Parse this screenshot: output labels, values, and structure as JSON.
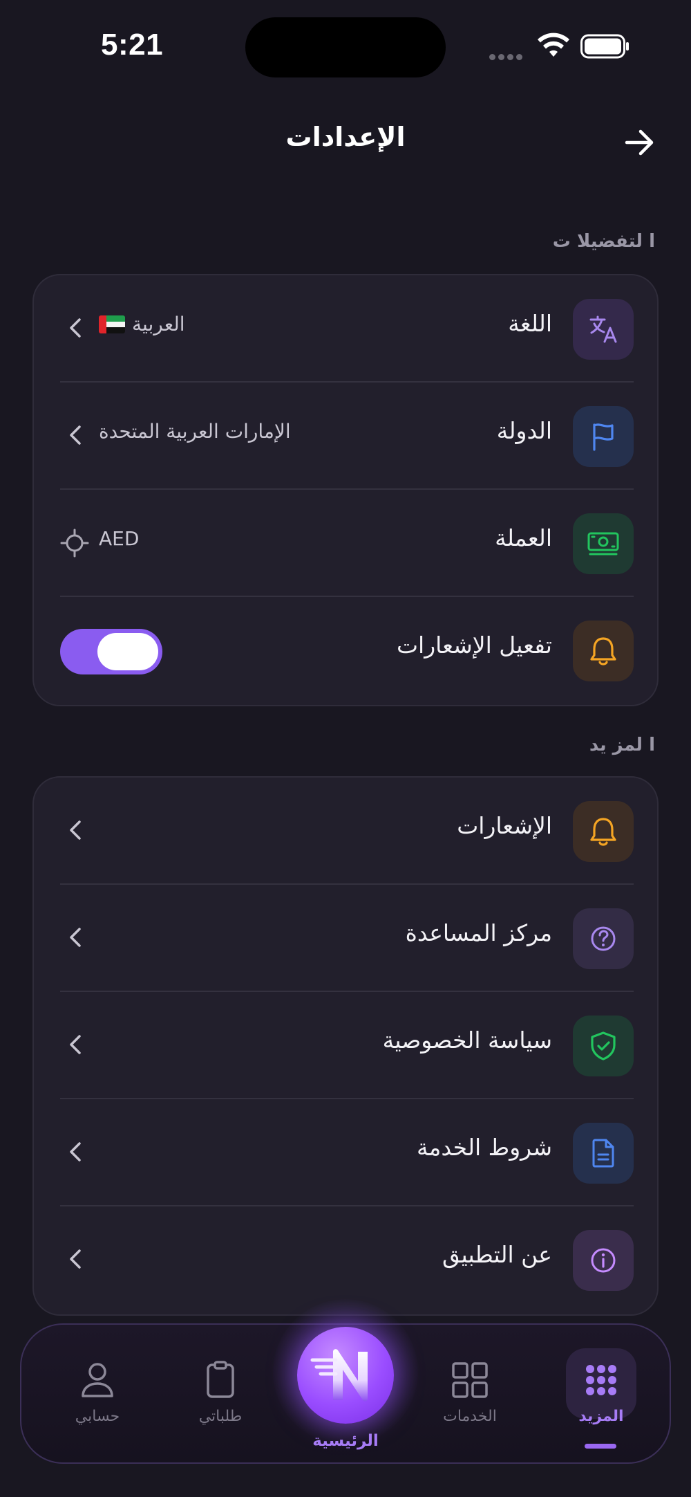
{
  "status_bar": {
    "time": "5:21"
  },
  "header": {
    "title": "الإعدادات"
  },
  "preferences": {
    "section_label": "ا لتفضيلا ت",
    "language": {
      "label": "اللغة",
      "value": "العربية"
    },
    "country": {
      "label": "الدولة",
      "value": "الإمارات العربية المتحدة"
    },
    "currency": {
      "label": "العملة",
      "value": "AED"
    },
    "notifications": {
      "label": "تفعيل الإشعارات",
      "enabled": true
    }
  },
  "more": {
    "section_label": "ا لمز يد",
    "items": [
      {
        "label": "الإشعارات",
        "icon": "bell-icon"
      },
      {
        "label": "مركز المساعدة",
        "icon": "help-circle-icon"
      },
      {
        "label": "سياسة الخصوصية",
        "icon": "shield-check-icon"
      },
      {
        "label": "شروط الخدمة",
        "icon": "document-icon"
      },
      {
        "label": "عن التطبيق",
        "icon": "info-icon"
      }
    ]
  },
  "bottom_nav": {
    "account": "حسابي",
    "orders": "طلباتي",
    "home": "الرئيسية",
    "services": "الخدمات",
    "more": "المزيد",
    "active": "more"
  },
  "colors": {
    "background": "#191721",
    "card": "#221f2c",
    "accent": "#8a5cf0",
    "toggle_on": "#8a5cf0"
  }
}
